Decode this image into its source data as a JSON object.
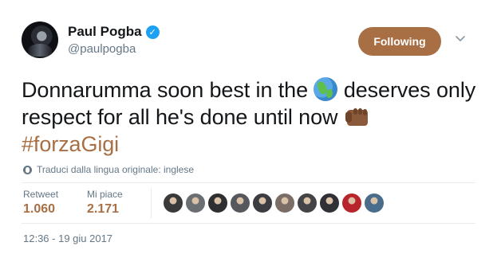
{
  "user": {
    "display_name": "Paul Pogba",
    "handle": "@paulpogba",
    "verified_icon": "verified-badge-icon"
  },
  "actions": {
    "follow_label": "Following",
    "more_icon": "chevron-down-icon"
  },
  "tweet": {
    "part1": "Donnarumma soon best in the ",
    "emoji1": "globe-americas-emoji",
    "part2": " deserves only respect for all he's done until now ",
    "emoji2": "fist-bump-emoji",
    "hashtag": "#forzaGigi"
  },
  "translate": {
    "icon": "globe-icon",
    "label": "Traduci dalla lingua originale: inglese"
  },
  "stats": {
    "retweets_label": "Retweet",
    "retweets_value": "1.060",
    "likes_label": "Mi piace",
    "likes_value": "2.171"
  },
  "likers": [
    "#3a3a3a",
    "#6b6e73",
    "#2d2f33",
    "#55585c",
    "#3b3d40",
    "#7a6e66",
    "#444448",
    "#2f3136",
    "#b8262b",
    "#4a6d8c"
  ],
  "timestamp": "12:36 - 19 giu 2017",
  "colors": {
    "accent": "#a86f45",
    "verified": "#1da1f2",
    "muted": "#657786"
  }
}
